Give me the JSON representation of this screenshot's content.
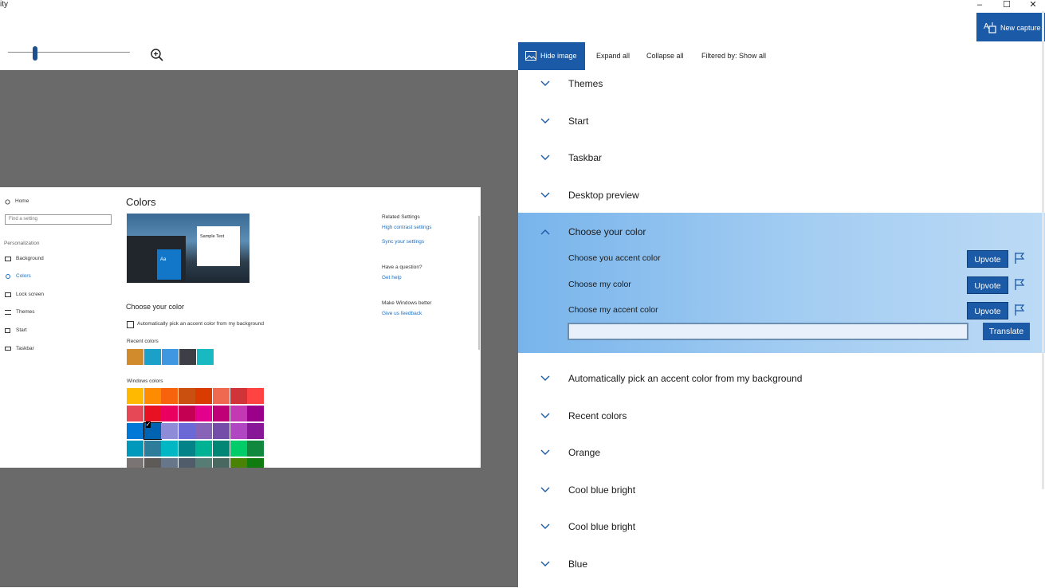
{
  "window": {
    "title": "ity",
    "minimize": "–",
    "maximize": "☐",
    "close": "✕"
  },
  "new_capture": {
    "label": "New capture",
    "icon": "new-capture-icon"
  },
  "zoom": {
    "level": 0.22,
    "icon": "zoom-in-icon"
  },
  "toolbar": {
    "hide_image": "Hide image",
    "expand_all": "Expand all",
    "collapse_all": "Collapse all",
    "filter": "Filtered by: Show all"
  },
  "screenshot": {
    "nav": {
      "home": "Home",
      "search_placeholder": "Find a setting",
      "section": "Personalization",
      "items": [
        "Background",
        "Colors",
        "Lock screen",
        "Themes",
        "Start",
        "Taskbar"
      ]
    },
    "title": "Colors",
    "preview_text": "Sample Text",
    "preview_tile": "Aa",
    "choose_heading": "Choose your color",
    "auto_checkbox": "Automatically pick an accent color from my background",
    "recent_label": "Recent colors",
    "windows_label": "Windows colors",
    "recent_colors": [
      "#d18b2c",
      "#1ba1c9",
      "#3f97e2",
      "#3c3f45",
      "#19b9c1"
    ],
    "windows_colors": [
      [
        "#ffb900",
        "#ff8c00",
        "#f7630c",
        "#ca5010",
        "#da3b01",
        "#ef6950",
        "#d13438",
        "#ff4343"
      ],
      [
        "#e74856",
        "#e81123",
        "#ea005e",
        "#c30052",
        "#e3008c",
        "#bf0077",
        "#c239b3",
        "#9a0089"
      ],
      [
        "#0078d7",
        "#0063b1",
        "#8e8cd8",
        "#6b69d6",
        "#8764b8",
        "#744da9",
        "#b146c2",
        "#881798"
      ],
      [
        "#0099bc",
        "#2d7d9a",
        "#00b7c3",
        "#038387",
        "#00b294",
        "#018574",
        "#00cc6a",
        "#10893e"
      ],
      [
        "#7a7574",
        "#5d5a58",
        "#68768a",
        "#515c6b",
        "#567c73",
        "#486860",
        "#498205",
        "#107c10"
      ]
    ],
    "related": {
      "heading": "Related Settings",
      "links": [
        "High contrast settings",
        "Sync your settings"
      ],
      "question": "Have a question?",
      "help": "Get help",
      "better": "Make Windows better",
      "feedback": "Give us feedback"
    }
  },
  "tree": {
    "top_nodes": [
      "Themes",
      "Start",
      "Taskbar",
      "Desktop preview"
    ],
    "expanded": {
      "label": "Choose your color",
      "children": [
        "Choose you accent color",
        "Choose my color",
        "Choose my accent color"
      ],
      "upvote_label": "Upvote",
      "translate_label": "Translate",
      "translate_value": ""
    },
    "bottom_nodes": [
      "Automatically pick an accent color from my background",
      "Recent colors",
      "Orange",
      "Cool blue bright",
      "Cool blue bright",
      "Blue"
    ]
  },
  "colors": {
    "accent": "#1a5aa6",
    "highlight": "#78b4eb",
    "canvas": "#6a6a6a"
  }
}
